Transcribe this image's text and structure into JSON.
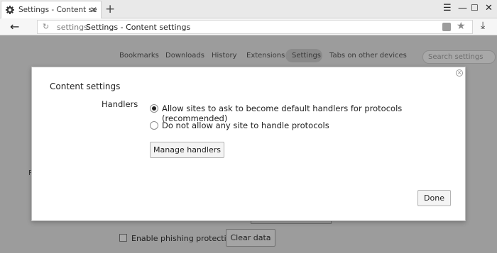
{
  "tab": {
    "title": "Settings - Content settings"
  },
  "address": {
    "host": "settings",
    "page_title": "Settings - Content settings"
  },
  "settings_nav": [
    "Bookmarks",
    "Downloads",
    "History",
    "Extensions",
    "Settings",
    "Tabs on other devices"
  ],
  "search": {
    "placeholder": "Search settings"
  },
  "background": {
    "phishing_label": "Enable phishing protection",
    "clear_data_label": "Clear data",
    "fragment_letter": "P"
  },
  "dialog": {
    "title": "Content settings",
    "section_label": "Handlers",
    "options": [
      {
        "label": "Allow sites to ask to become default handlers for protocols (recommended)",
        "selected": true
      },
      {
        "label": "Do not allow any site to handle protocols",
        "selected": false
      }
    ],
    "manage_label": "Manage handlers",
    "done_label": "Done"
  }
}
